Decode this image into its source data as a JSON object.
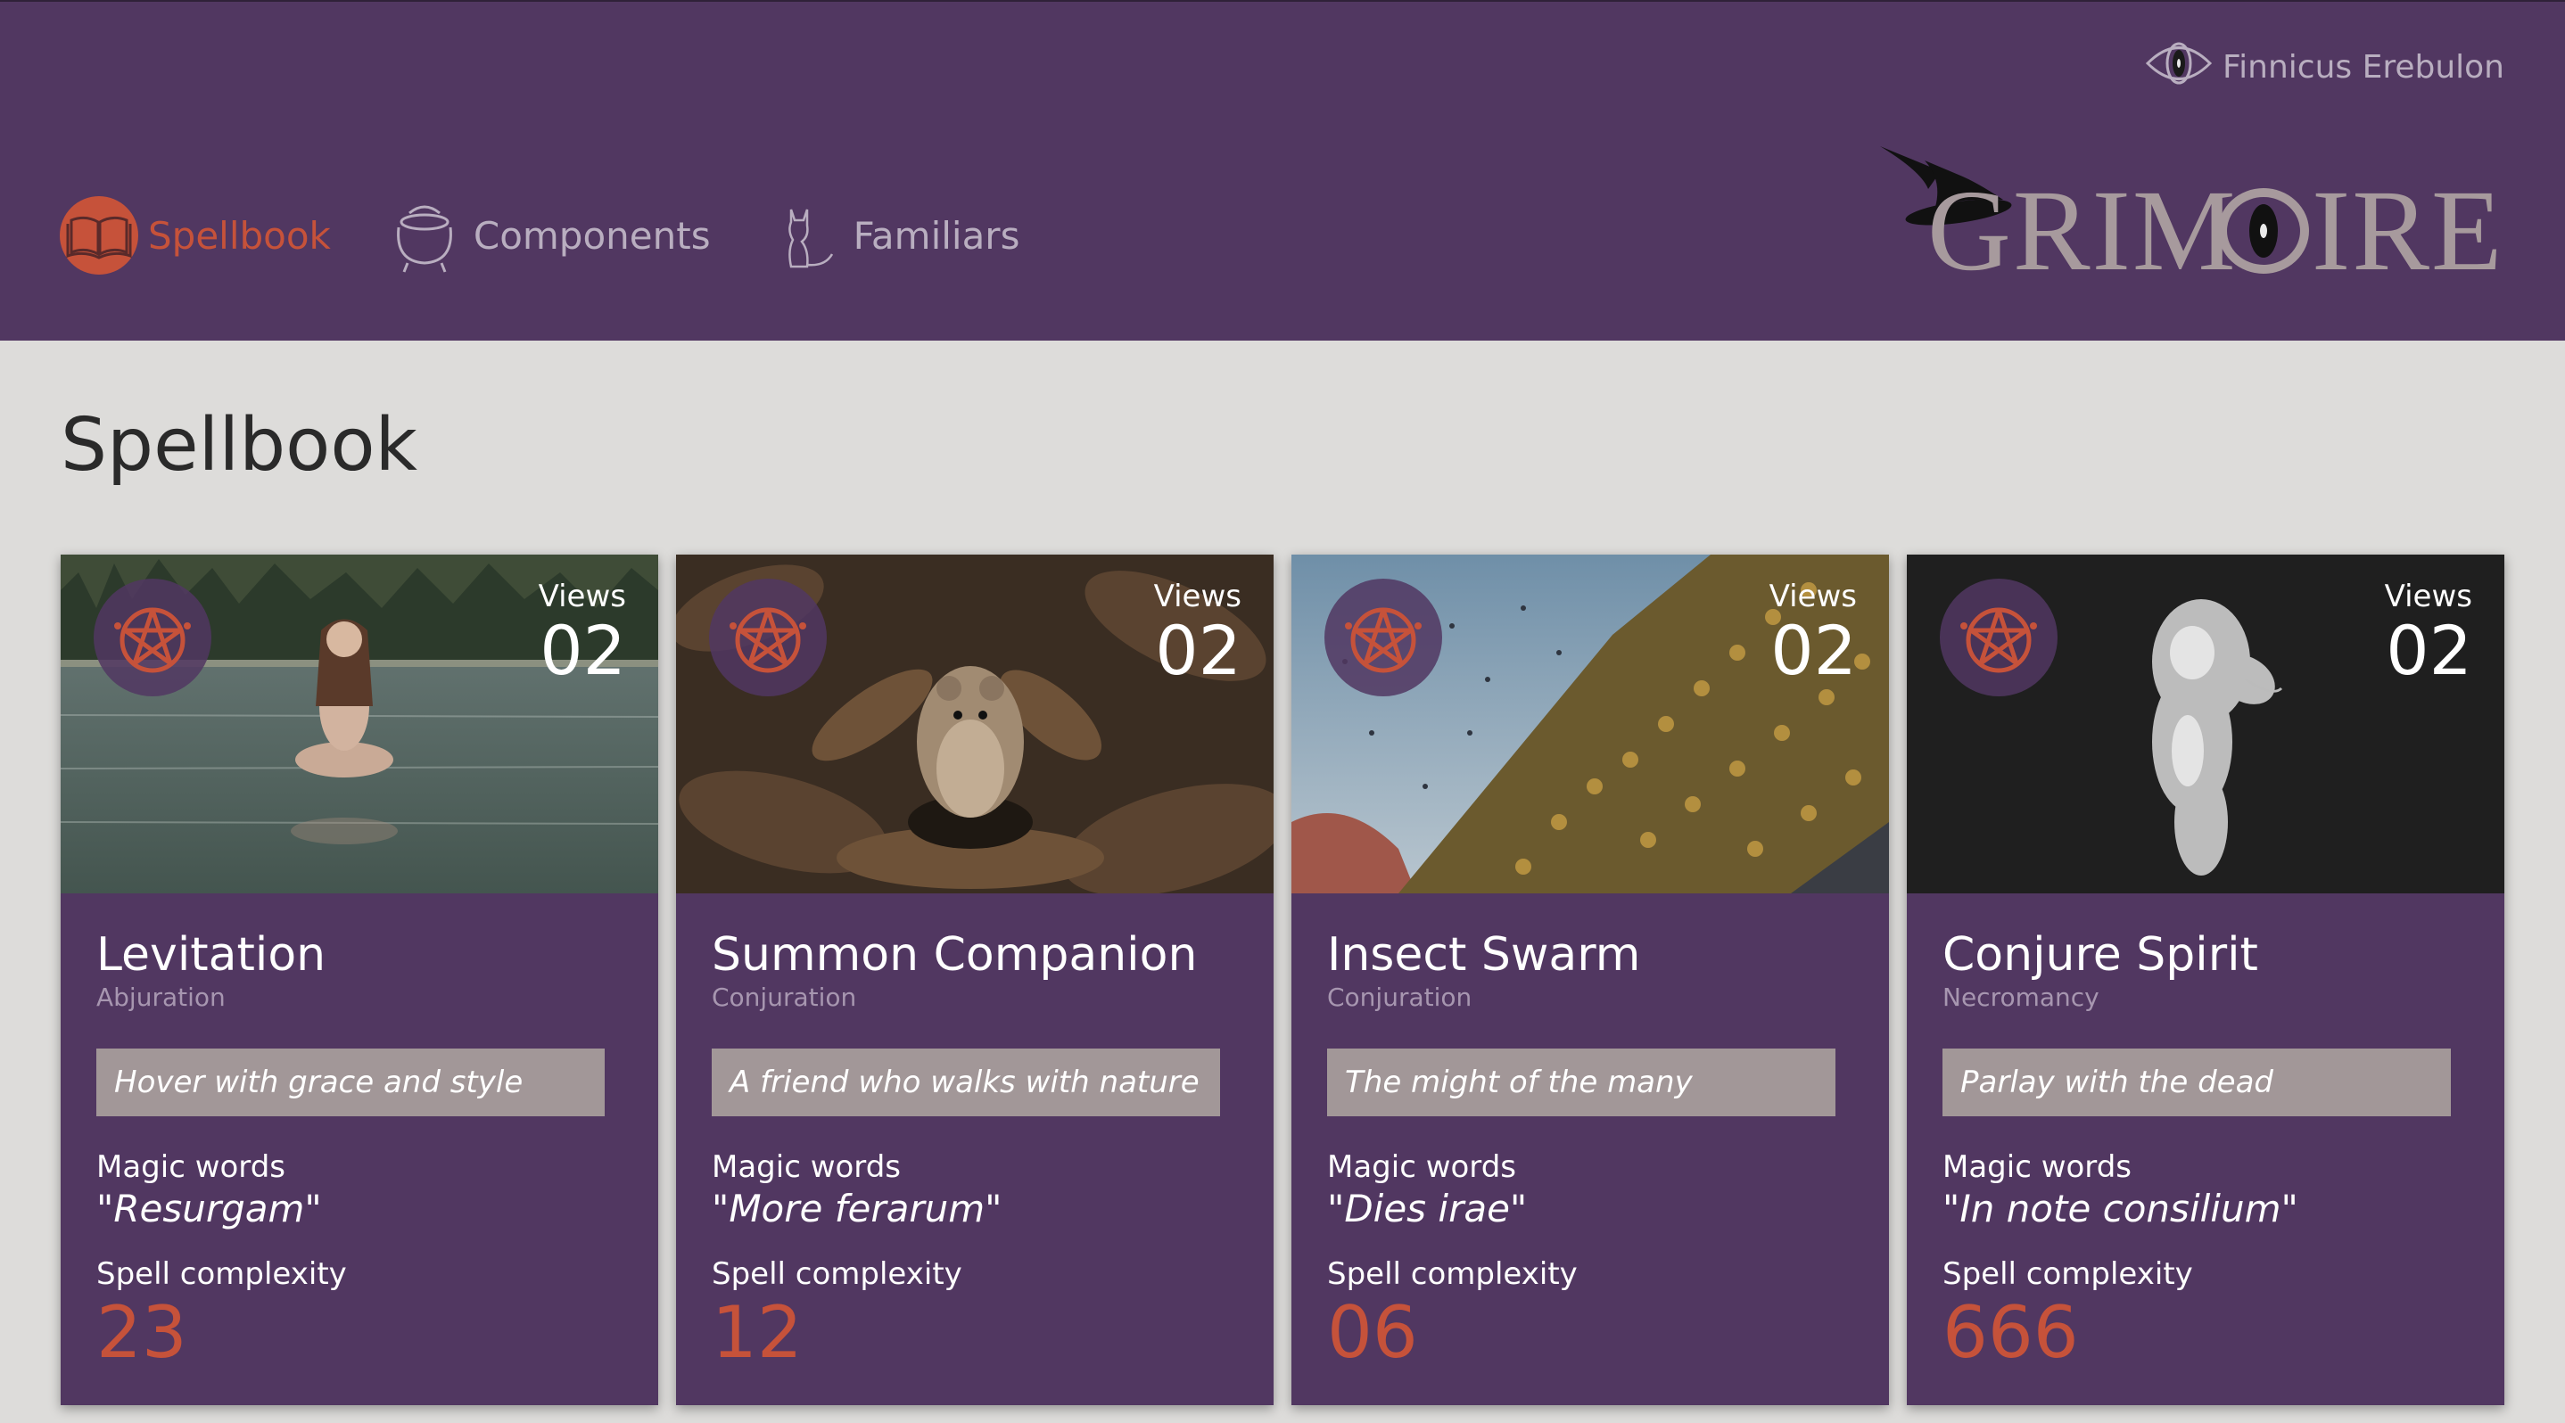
{
  "user": {
    "name": "Finnicus Erebulon",
    "icon": "eye-icon"
  },
  "nav": {
    "items": [
      {
        "label": "Spellbook",
        "icon": "spellbook-icon",
        "active": true
      },
      {
        "label": "Components",
        "icon": "cauldron-icon",
        "active": false
      },
      {
        "label": "Familiars",
        "icon": "cat-icon",
        "active": false
      }
    ]
  },
  "logo": {
    "text": "GRIMOIRE"
  },
  "page": {
    "title": "Spellbook"
  },
  "colors": {
    "header": "#513761",
    "accent": "#c6523a",
    "background": "#dddcda",
    "tagline": "#a29798"
  },
  "cards": [
    {
      "title": "Levitation",
      "school": "Abjuration",
      "tagline": "Hover with grace and style",
      "views_label": "Views",
      "views": "02",
      "magic_label": "Magic words",
      "magic_words": "\"Resurgam\"",
      "complexity_label": "Spell complexity",
      "complexity": "23",
      "image": "floating-woman-over-lake"
    },
    {
      "title": "Summon Companion",
      "school": "Conjuration",
      "tagline": "A friend who walks with nature",
      "views_label": "Views",
      "views": "02",
      "magic_label": "Magic words",
      "magic_words": "\"More ferarum\"",
      "complexity_label": "Spell complexity",
      "complexity": "12",
      "image": "vole-in-leaves"
    },
    {
      "title": "Insect Swarm",
      "school": "Conjuration",
      "tagline": "The might of the many",
      "views_label": "Views",
      "views": "02",
      "magic_label": "Magic words",
      "magic_words": "\"Dies irae\"",
      "complexity_label": "Spell complexity",
      "complexity": "06",
      "image": "bee-swarm"
    },
    {
      "title": "Conjure Spirit",
      "school": "Necromancy",
      "tagline": "Parlay with the dead",
      "views_label": "Views",
      "views": "02",
      "magic_label": "Magic words",
      "magic_words": "\"In note consilium\"",
      "complexity_label": "Spell complexity",
      "complexity": "666",
      "image": "ghostly-spirit"
    }
  ]
}
